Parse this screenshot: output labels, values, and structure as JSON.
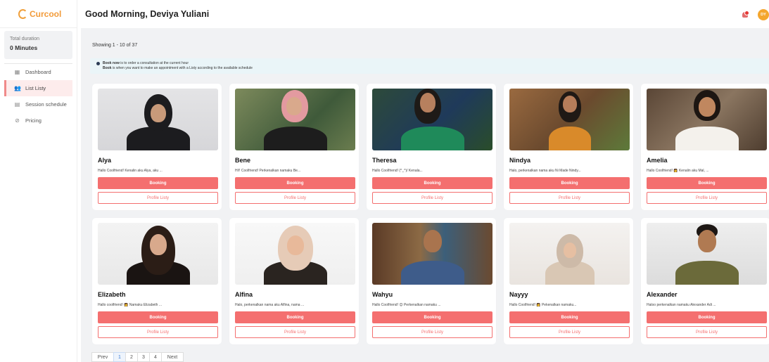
{
  "app": {
    "logo_text": "Curcool",
    "greeting": "Good Morning, Deviya Yuliani",
    "avatar_initials": "DY",
    "brand_color": "#f29b3a",
    "accent_color": "#f46f6f"
  },
  "sidebar": {
    "duration_label": "Total duration",
    "duration_value": "0 Minutes",
    "items": [
      {
        "label": "Dashboard",
        "icon": "grid-icon"
      },
      {
        "label": "List Listy",
        "icon": "users-icon"
      },
      {
        "label": "Session schedule",
        "icon": "calendar-icon"
      },
      {
        "label": "Pricing",
        "icon": "check-circle-icon"
      }
    ]
  },
  "main": {
    "showing": "Showing 1 - 10 of 37",
    "info": {
      "line1_bold": "Book now",
      "line1_rest": " is to order a consultation at the current hour",
      "line2_bold": "Book",
      "line2_rest": " is when you want to make an appointment with a Listy according to the available schedule"
    },
    "cards": [
      {
        "name": "Alya",
        "bio": "Hallo Coolfriend! Kenalin aku Alya, aku ..."
      },
      {
        "name": "Bene",
        "bio": "Hi!! Coolfriend! Perkenalkan namaku Be..."
      },
      {
        "name": "Theresa",
        "bio": "Hallo Coolfriend! (^_^)/ Kenala..."
      },
      {
        "name": "Nindya",
        "bio": "Halo, perkenalkan nama aku Ni Made Nindy..."
      },
      {
        "name": "Amelia",
        "bio": "Hallo Coolfriend! 👩 Kenalin aku Mal, ..."
      },
      {
        "name": "Elizabeth",
        "bio": "Hallo coolfriend! 👩 Namaku Elizabeth ..."
      },
      {
        "name": "Alfina",
        "bio": "Halo, perkenalkan nama aku Alfina, nama ..."
      },
      {
        "name": "Wahyu",
        "bio": "Hallo Coolfriend! 😊 Perkenalkan namaku ..."
      },
      {
        "name": "Nayyy",
        "bio": "Hallo Coolfriend! 👩 Pekenalkan namaku..."
      },
      {
        "name": "Alexander",
        "bio": "Haloo perkenalkan namaku Alexander Adi ..."
      }
    ],
    "booking_label": "Booking",
    "profile_label": "Profile Listy"
  },
  "pagination": {
    "prev": "Prev",
    "pages": [
      "1",
      "2",
      "3",
      "4"
    ],
    "next": "Next",
    "current": "1"
  }
}
